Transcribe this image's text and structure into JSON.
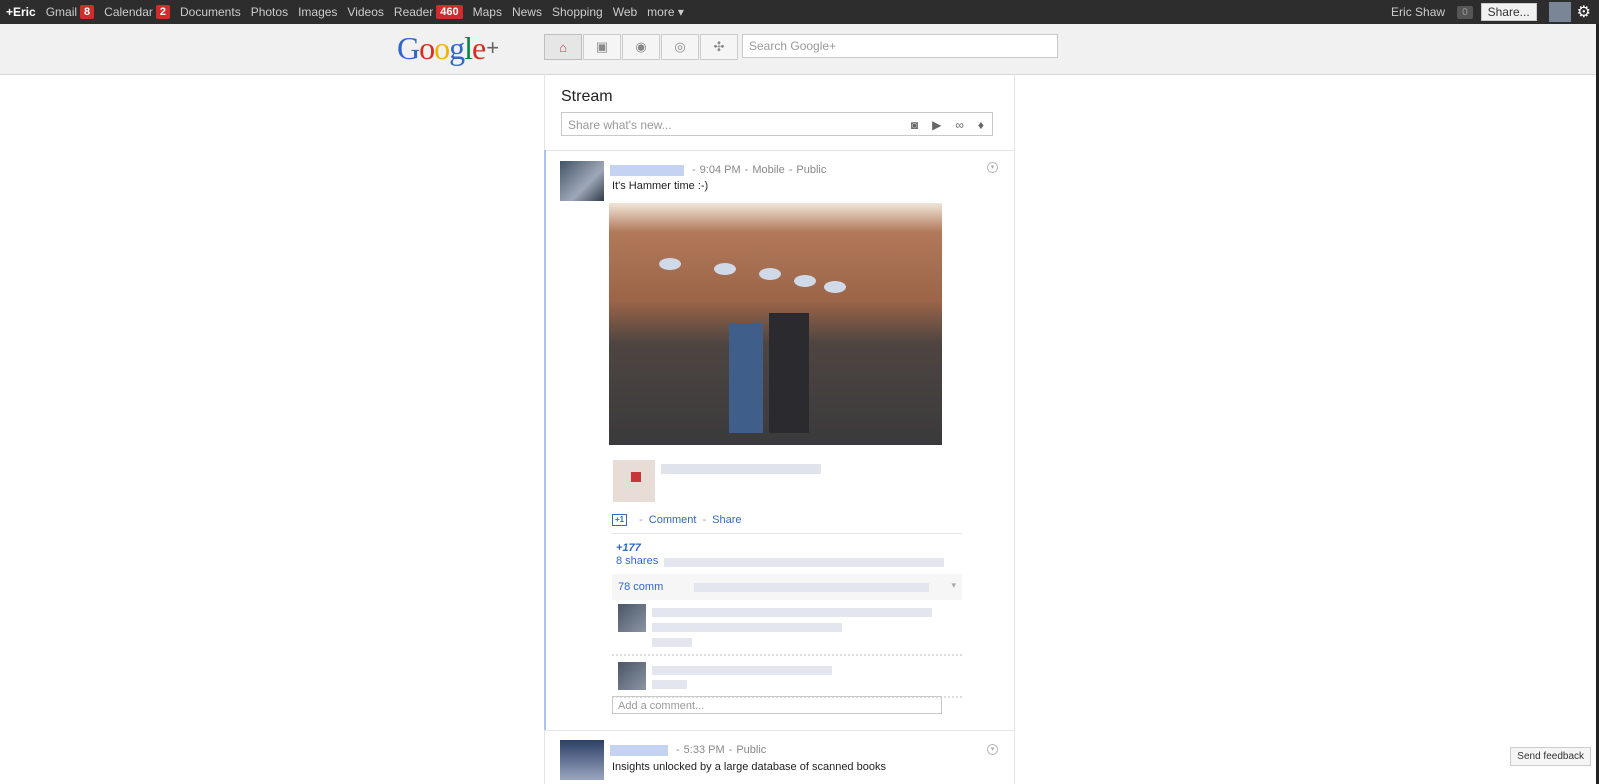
{
  "topbar": {
    "nav": [
      {
        "label": "+Eric",
        "active": true
      },
      {
        "label": "Gmail",
        "badge": "8"
      },
      {
        "label": "Calendar",
        "badge": "2"
      },
      {
        "label": "Documents"
      },
      {
        "label": "Photos"
      },
      {
        "label": "Images"
      },
      {
        "label": "Videos"
      },
      {
        "label": "Reader",
        "badge": "460"
      },
      {
        "label": "Maps"
      },
      {
        "label": "News"
      },
      {
        "label": "Shopping"
      },
      {
        "label": "Web"
      },
      {
        "label": "more ▾"
      }
    ],
    "user_name": "Eric Shaw",
    "notifications": "0",
    "share_label": "Share..."
  },
  "header": {
    "search_placeholder": "Search Google+"
  },
  "stream": {
    "title": "Stream",
    "share_placeholder": "Share what's new..."
  },
  "post1": {
    "time": "9:04 PM",
    "source": "Mobile",
    "visibility": "Public",
    "text": "It's Hammer time :-)",
    "plus_one": "+1",
    "comment_label": "Comment",
    "share_label": "Share",
    "plus_count": "+177",
    "shares": "8 shares",
    "comments_count": "78 comm",
    "add_comment": "Add a comment..."
  },
  "post2": {
    "time": "5:33 PM",
    "visibility": "Public",
    "text": "Insights unlocked by a large database of scanned books"
  },
  "feedback_label": "Send feedback"
}
